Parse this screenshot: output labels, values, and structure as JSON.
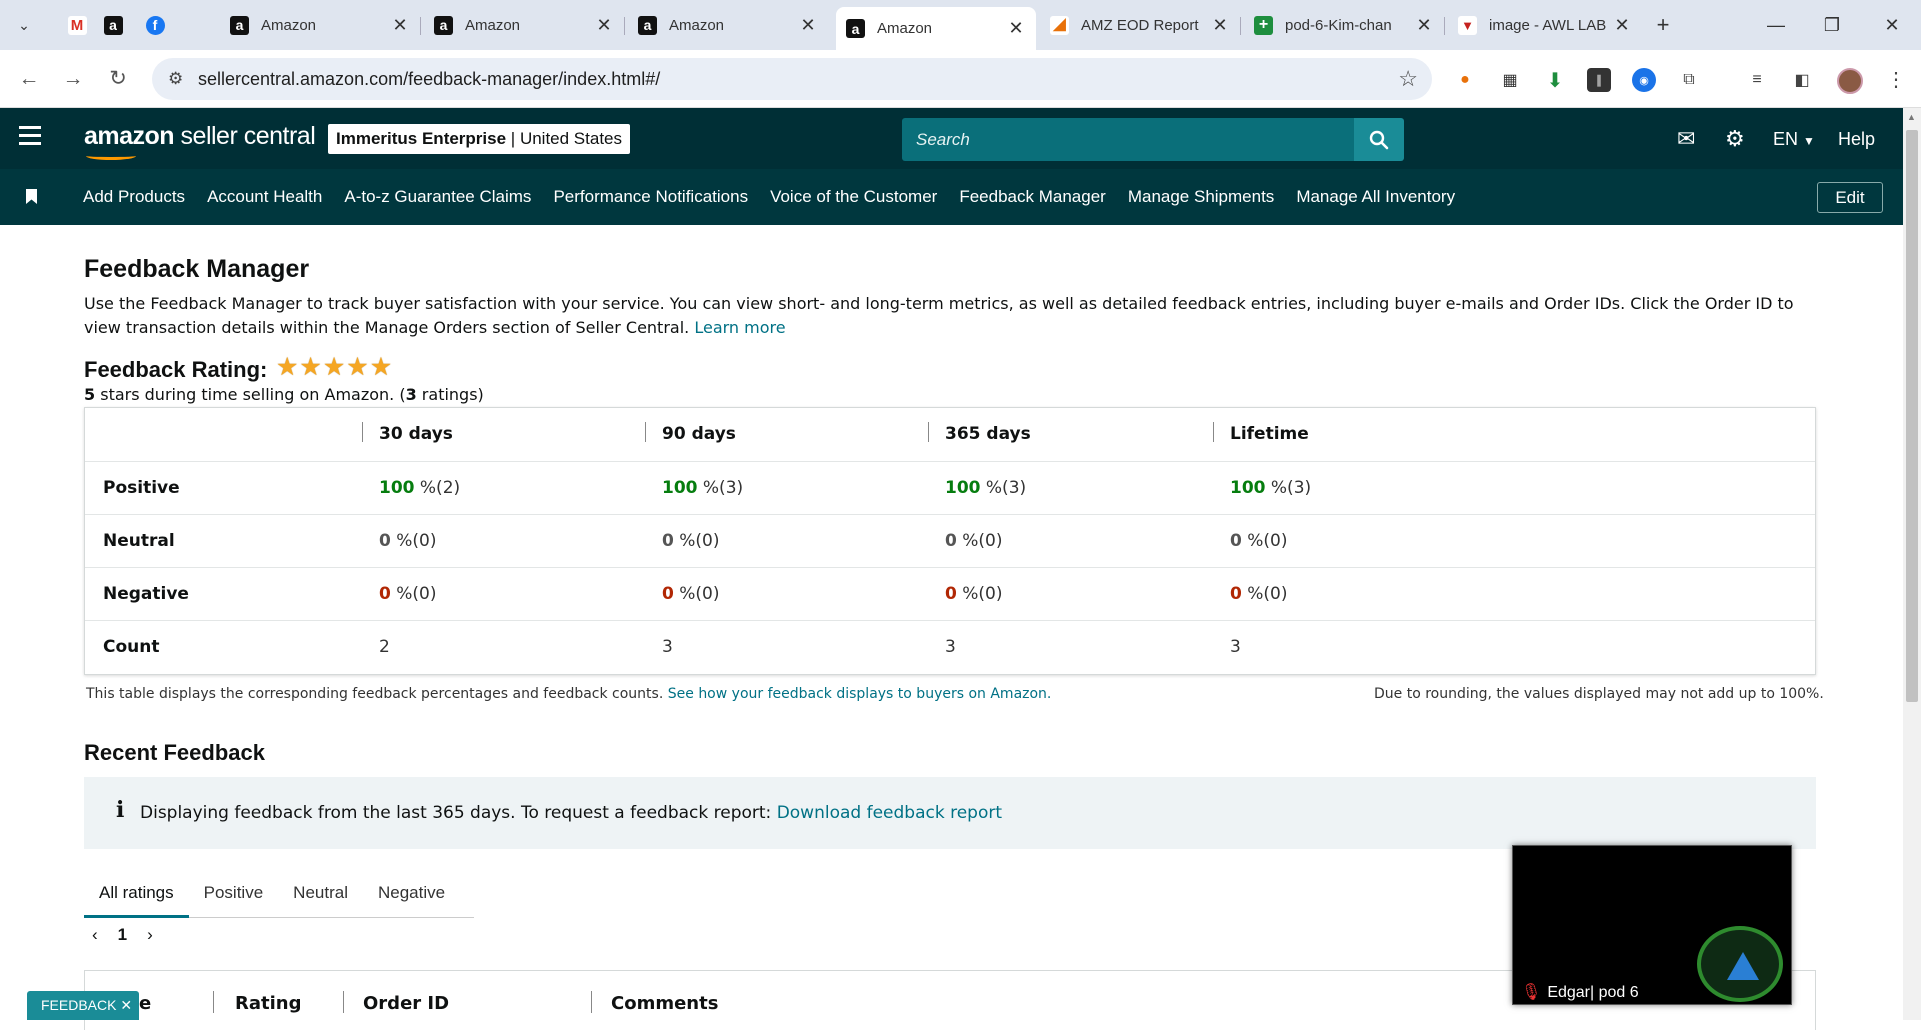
{
  "browser": {
    "tabs": [
      {
        "label": "Amazon",
        "icon": "amazon-icon"
      },
      {
        "label": "Amazon",
        "icon": "amazon-icon"
      },
      {
        "label": "Amazon",
        "icon": "amazon-icon"
      },
      {
        "label": "Amazon",
        "icon": "amazon-icon",
        "active": true
      },
      {
        "label": "AMZ EOD Report",
        "icon": "report-icon"
      },
      {
        "label": "pod-6-Kim-chan",
        "icon": "sheets-icon"
      },
      {
        "label": "image - AWL LAB",
        "icon": "awl-icon"
      }
    ],
    "url": "sellercentral.amazon.com/feedback-manager/index.html#/"
  },
  "header": {
    "logo_prefix": "amazon",
    "logo_suffix": " seller central",
    "account_name": "Immeritus Enterprise",
    "account_sep": " | ",
    "account_region": "United States",
    "search_placeholder": "Search",
    "lang": "EN",
    "help": "Help"
  },
  "nav": {
    "links": [
      "Add Products",
      "Account Health",
      "A-to-z Guarantee Claims",
      "Performance Notifications",
      "Voice of the Customer",
      "Feedback Manager",
      "Manage Shipments",
      "Manage All Inventory"
    ],
    "edit": "Edit"
  },
  "page": {
    "title": "Feedback Manager",
    "intro": "Use the Feedback Manager to track buyer satisfaction with your service. You can view short- and long-term metrics, as well as detailed feedback entries, including buyer e-mails and Order IDs. Click the Order ID to view transaction details within the Manage Orders section of Seller Central.",
    "learn_more": "Learn more",
    "rating_title": "Feedback Rating:",
    "rating_stars": 5,
    "rating_sub_stars": "5",
    "rating_sub_mid": " stars during time selling on Amazon. (",
    "rating_sub_count": "3",
    "rating_sub_end": " ratings)"
  },
  "feedback_table": {
    "columns": [
      "30 days",
      "90 days",
      "365 days",
      "Lifetime"
    ],
    "rows": [
      {
        "label": "Positive",
        "cells": [
          {
            "pct": "100",
            "rest": " %(2)"
          },
          {
            "pct": "100",
            "rest": " %(3)"
          },
          {
            "pct": "100",
            "rest": " %(3)"
          },
          {
            "pct": "100",
            "rest": " %(3)"
          }
        ]
      },
      {
        "label": "Neutral",
        "cells": [
          {
            "pct": "0",
            "rest": " %(0)"
          },
          {
            "pct": "0",
            "rest": " %(0)"
          },
          {
            "pct": "0",
            "rest": " %(0)"
          },
          {
            "pct": "0",
            "rest": " %(0)"
          }
        ]
      },
      {
        "label": "Negative",
        "cells": [
          {
            "pct": "0",
            "rest": " %(0)"
          },
          {
            "pct": "0",
            "rest": " %(0)"
          },
          {
            "pct": "0",
            "rest": " %(0)"
          },
          {
            "pct": "0",
            "rest": " %(0)"
          }
        ]
      },
      {
        "label": "Count",
        "cells": [
          {
            "pct": "",
            "rest": "2"
          },
          {
            "pct": "",
            "rest": "3"
          },
          {
            "pct": "",
            "rest": "3"
          },
          {
            "pct": "",
            "rest": "3"
          }
        ]
      }
    ],
    "footnote": "This table displays the corresponding feedback percentages and feedback counts.",
    "footnote_link": "See how your feedback displays to buyers on Amazon.",
    "rounding_note": "Due to rounding, the values displayed may not add up to 100%."
  },
  "recent": {
    "title": "Recent Feedback",
    "alert_text": "Displaying feedback from the last 365 days. To request a feedback report:",
    "alert_link": "Download feedback report",
    "tabs": [
      "All ratings",
      "Positive",
      "Neutral",
      "Negative"
    ],
    "page": "1",
    "columns": [
      "e",
      "Rating",
      "Order ID",
      "Comments"
    ]
  },
  "feedback_button": "FEEDBACK ✕",
  "video": {
    "name": "Edgar| pod 6"
  },
  "colors": {
    "header_bg": "#002f36",
    "nav_bg": "#00373e",
    "accent": "#007185",
    "positive": "#067d0f",
    "negative": "#b12704",
    "star": "#f5a623"
  }
}
